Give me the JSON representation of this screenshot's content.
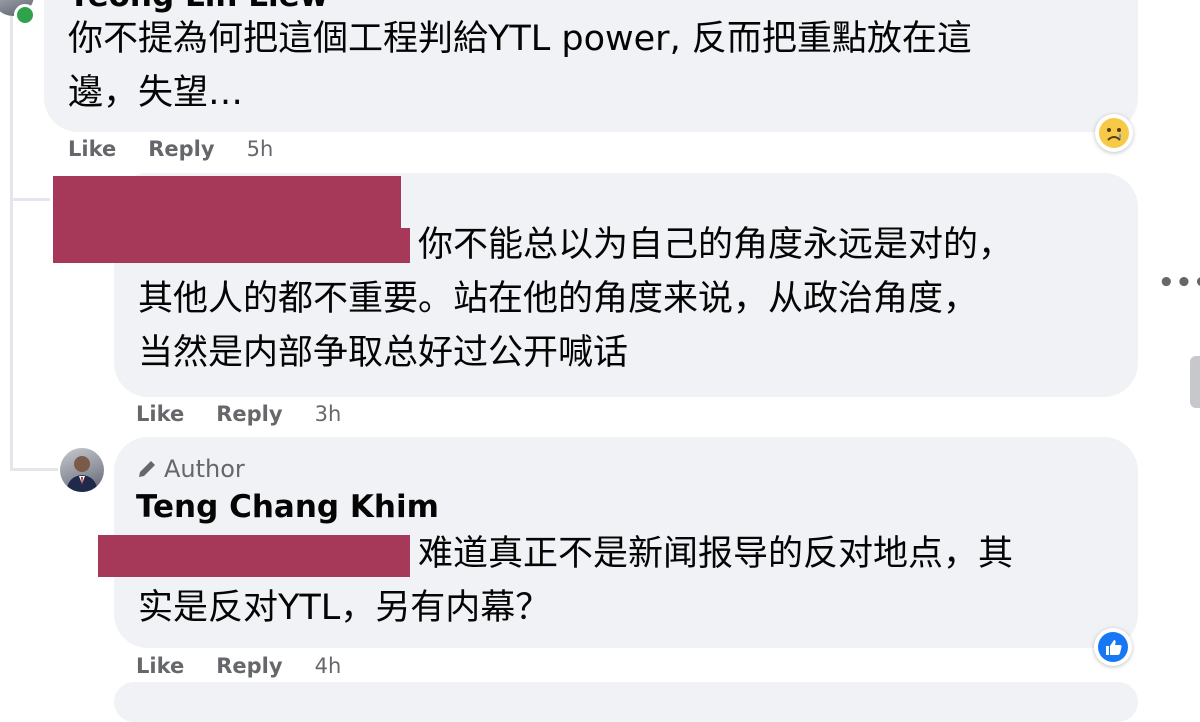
{
  "comments": [
    {
      "author": "Yeong Lin Liew",
      "text": "你不提為何把這個工程判給YTL power, 反而把重點放在這\n邊，失望…",
      "actions": {
        "like": "Like",
        "reply": "Reply",
        "time": "5h"
      },
      "reaction": "sad-emoji"
    },
    {
      "text": "你不能总以为自己的角度永远是对的，\n其他人的都不重要。站在他的角度来说，从政治角度，\n当然是内部争取总好过公开喊话",
      "actions": {
        "like": "Like",
        "reply": "Reply",
        "time": "3h"
      }
    },
    {
      "badge": "Author",
      "author": "Teng Chang Khim",
      "text": "难道真正不是新闻报导的反对地点，其\n实是反对YTL，另有内幕？",
      "actions": {
        "like": "Like",
        "reply": "Reply",
        "time": "4h"
      },
      "reaction": "like-thumb"
    }
  ],
  "more_label": "•••",
  "colors": {
    "bubble": "#f0f2f5",
    "meta": "#65676b",
    "redaction": "#a6385a",
    "like_blue": "#1877f2",
    "online": "#31a24c"
  }
}
